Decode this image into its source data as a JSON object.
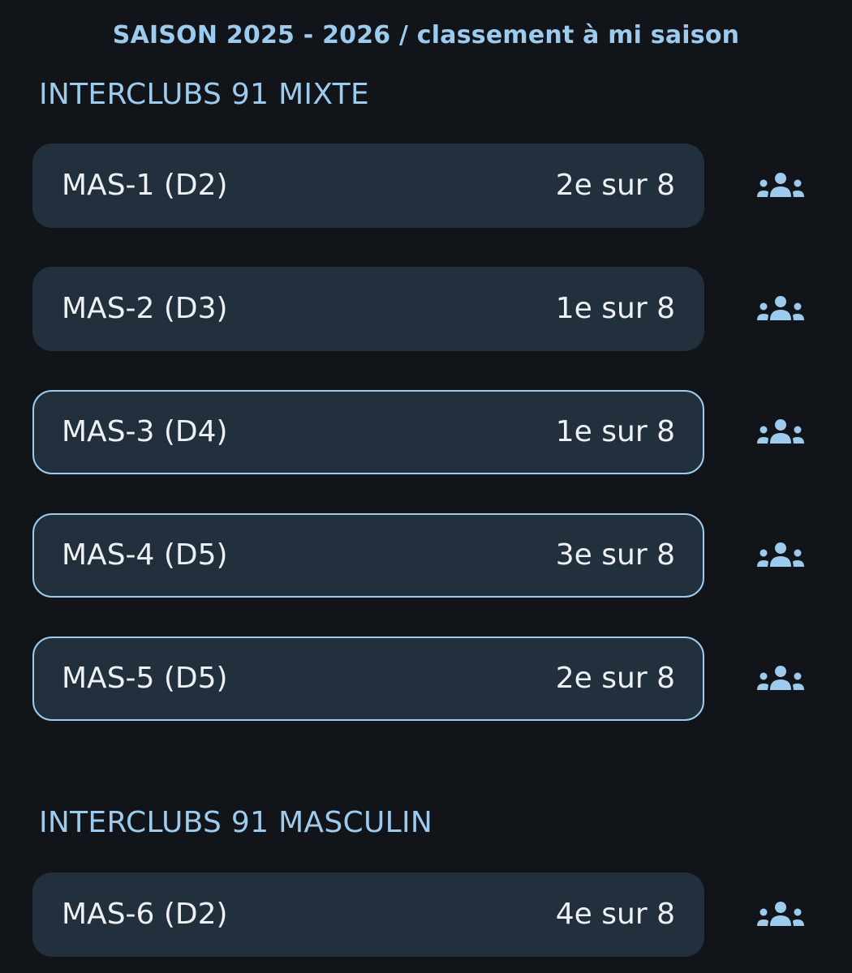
{
  "header": {
    "title": "SAISON 2025 - 2026 / classement à mi saison"
  },
  "colors": {
    "background": "#111418",
    "card": "#222f3c",
    "accent": "#9dcbee",
    "text": "#eef1f4"
  },
  "sections": [
    {
      "heading": "INTERCLUBS 91 MIXTE",
      "teams": [
        {
          "name": "MAS-1 (D2)",
          "rank": "2e sur 8",
          "icon": "groups-icon"
        },
        {
          "name": "MAS-2 (D3)",
          "rank": "1e sur 8",
          "icon": "groups-icon"
        },
        {
          "name": "MAS-3 (D4)",
          "rank": "1e sur 8",
          "icon": "groups-icon"
        },
        {
          "name": "MAS-4 (D5)",
          "rank": "3e sur 8",
          "icon": "groups-icon"
        },
        {
          "name": "MAS-5 (D5)",
          "rank": "2e sur 8",
          "icon": "groups-icon"
        }
      ]
    },
    {
      "heading": "INTERCLUBS 91 MASCULIN",
      "teams": [
        {
          "name": "MAS-6 (D2)",
          "rank": "4e sur 8",
          "icon": "groups-icon"
        }
      ]
    }
  ]
}
